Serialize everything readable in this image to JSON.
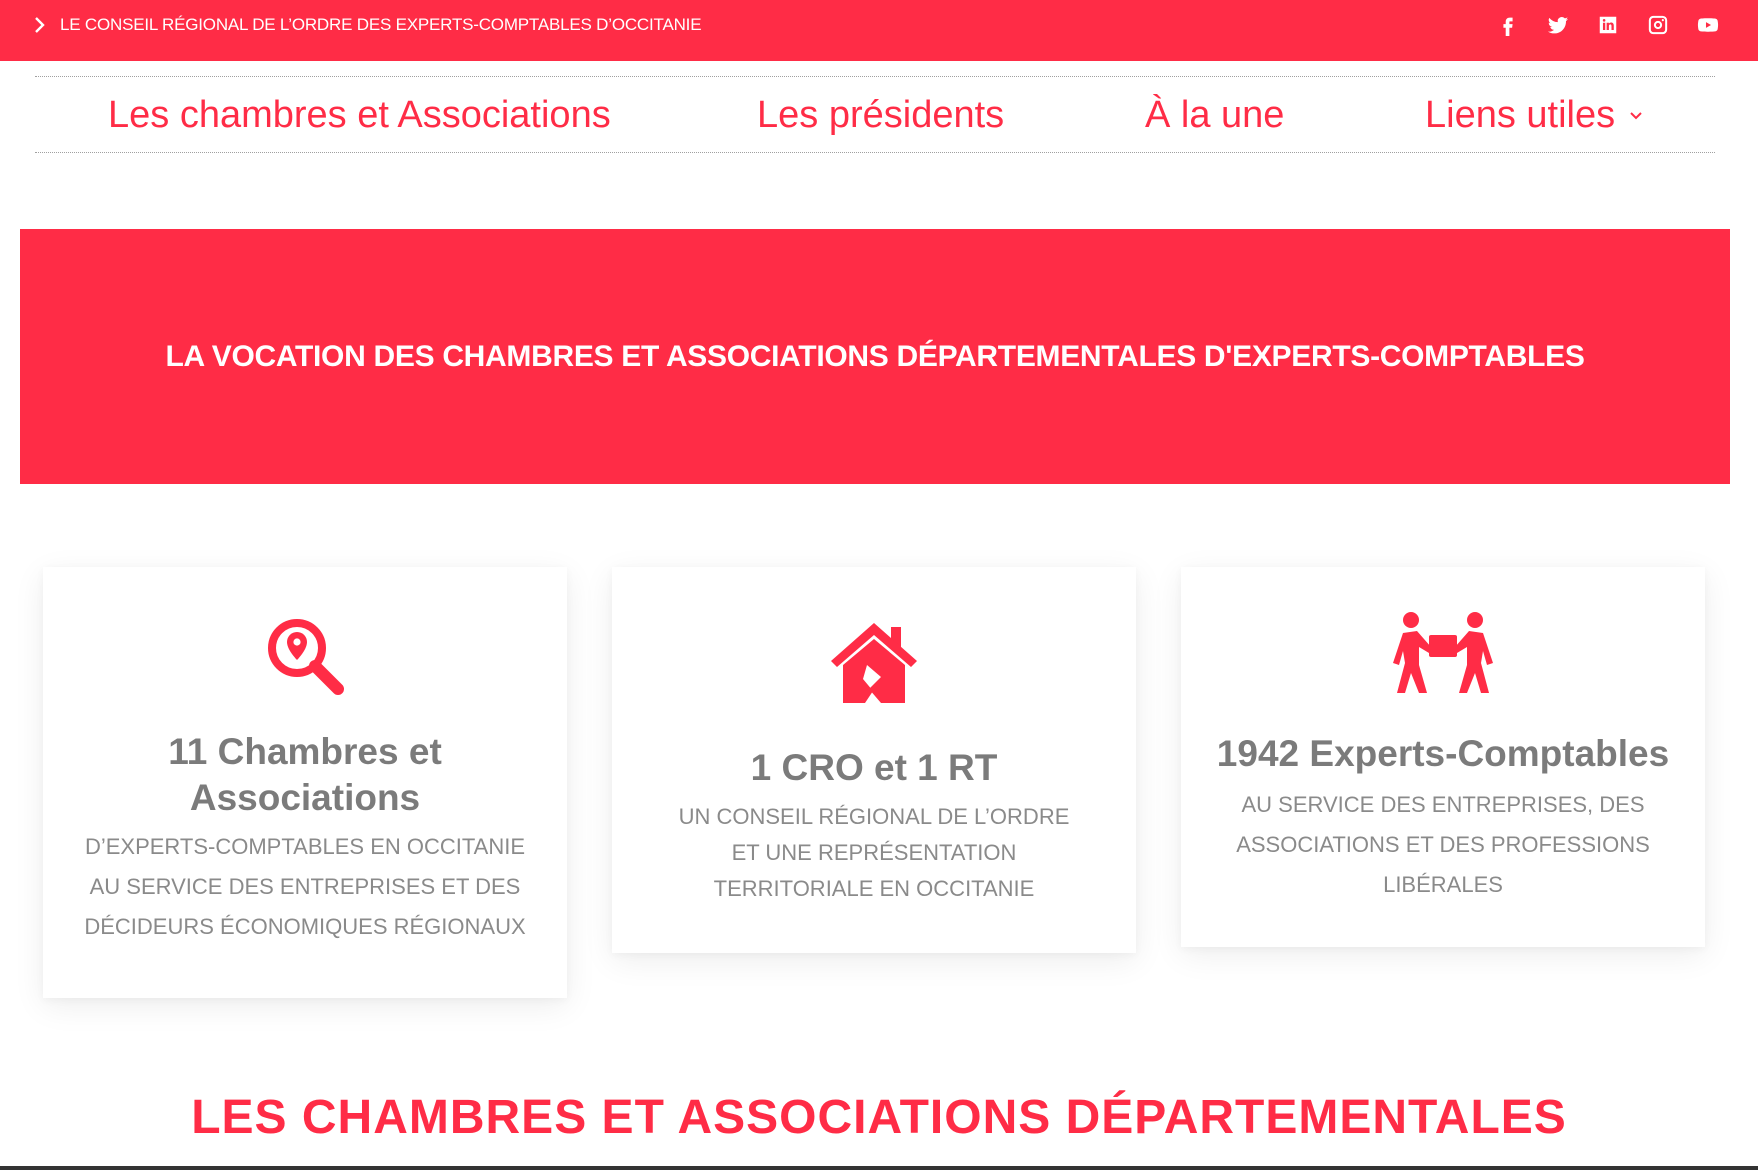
{
  "topbar": {
    "crumb": "LE CONSEIL RÉGIONAL DE L’ORDRE DES EXPERTS-COMPTABLES D’OCCITANIE",
    "socials": [
      "facebook-icon",
      "twitter-icon",
      "linkedin-icon",
      "instagram-icon",
      "youtube-icon"
    ],
    "background": "#ff2c46"
  },
  "nav": {
    "items": [
      {
        "label": "Les chambres et Associations"
      },
      {
        "label": "Les présidents"
      },
      {
        "label": "À la une"
      },
      {
        "label": "Liens utiles"
      }
    ]
  },
  "banner": {
    "title": "LA VOCATION DES CHAMBRES ET ASSOCIATIONS DÉPARTEMENTALES D'EXPERTS-COMPTABLES"
  },
  "cards": [
    {
      "icon": "search-location-icon",
      "stat_line1": "11 Chambres et",
      "stat_line2": "Associations",
      "desc": "D’EXPERTS-COMPTABLES EN OCCITANIE AU SERVICE DES ENTREPRISES ET DES DÉCIDEURS ÉCONOMIQUES RÉGIONAUX"
    },
    {
      "icon": "house-damage-icon",
      "stat": "1 CRO et 1 RT",
      "desc": "UN CONSEIL RÉGIONAL DE L’ORDRE ET UNE REPRÉSENTATION TERRITORIALE EN OCCITANIE"
    },
    {
      "icon": "people-carry-icon",
      "stat": "1942 Experts-Comptables",
      "desc": "AU SERVICE DES ENTREPRISES, DES ASSOCIATIONS ET DES PROFESSIONS LIBÉRALES"
    }
  ],
  "section": {
    "title": "LES CHAMBRES ET ASSOCIATIONS DÉPARTEMENTALES"
  },
  "colors": {
    "accent": "#ff2c46",
    "stat_text": "#7b7b7b",
    "desc_text": "#8a8a8a"
  }
}
